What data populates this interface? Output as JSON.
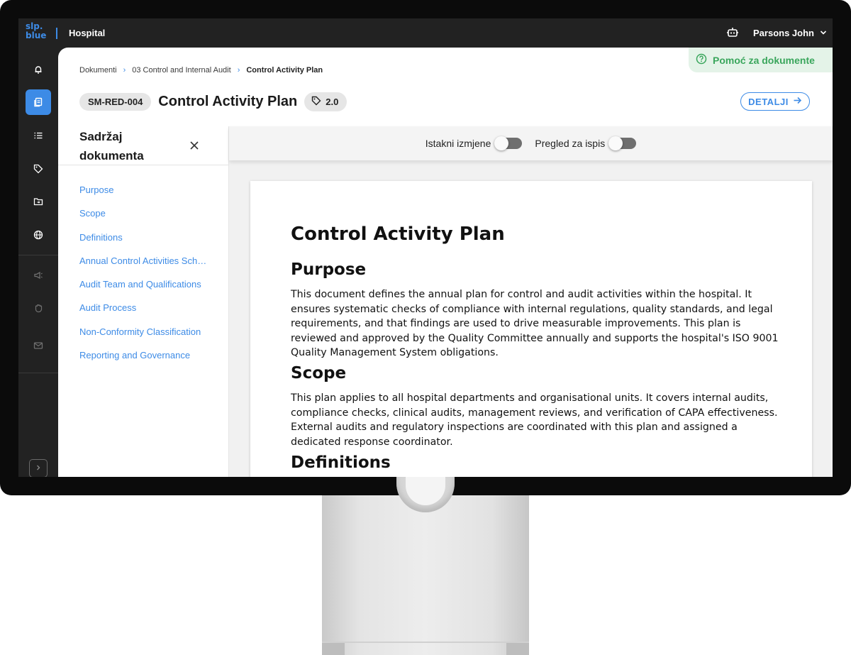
{
  "topbar": {
    "logo_line1": "slp.",
    "logo_line2": "blue",
    "app_name": "Hospital",
    "user_name": "Parsons John"
  },
  "rail": {
    "icons": [
      "bell-icon",
      "documents-icon",
      "list-icon",
      "tag-icon",
      "folder-icon",
      "globe-icon",
      "megaphone-icon",
      "hand-icon",
      "mail-icon"
    ],
    "active": "documents-icon"
  },
  "help": {
    "label": "Pomoć za dokumente"
  },
  "breadcrumb": {
    "items": [
      "Dokumenti",
      "03 Control and Internal Audit",
      "Control Activity Plan"
    ]
  },
  "document": {
    "code": "SM-RED-004",
    "title": "Control Activity Plan",
    "version": "2.0",
    "details_label": "DETALJI"
  },
  "toc": {
    "title": "Sadržaj dokumenta",
    "items": [
      "Purpose",
      "Scope",
      "Definitions",
      "Annual Control Activities Schedule",
      "Audit Team and Qualifications",
      "Audit Process",
      "Non-Conformity Classification",
      "Reporting and Governance"
    ]
  },
  "toggles": {
    "highlight_label": "Istakni izmjene",
    "highlight_on": false,
    "print_label": "Pregled za ispis",
    "print_on": false
  },
  "content": {
    "heading": "Control Activity Plan",
    "purpose_heading": "Purpose",
    "purpose_text": "This document defines the annual plan for control and audit activities within the hospital. It ensures systematic checks of compliance with internal regulations, quality standards, and legal requirements, and that findings are used to drive measurable improvements. This plan is reviewed and approved by the Quality Committee annually and supports the hospital's ISO 9001 Quality Management System obligations.",
    "scope_heading": "Scope",
    "scope_text": "This plan applies to all hospital departments and organisational units. It covers internal audits, compliance checks, clinical audits, management reviews, and verification of CAPA effectiveness. External audits and regulatory inspections are coordinated with this plan and assigned a dedicated response coordinator.",
    "definitions_heading": "Definitions"
  },
  "colors": {
    "accent": "#3d8be6",
    "help_green": "#3aa65c",
    "sidebar_bg": "#222222"
  }
}
